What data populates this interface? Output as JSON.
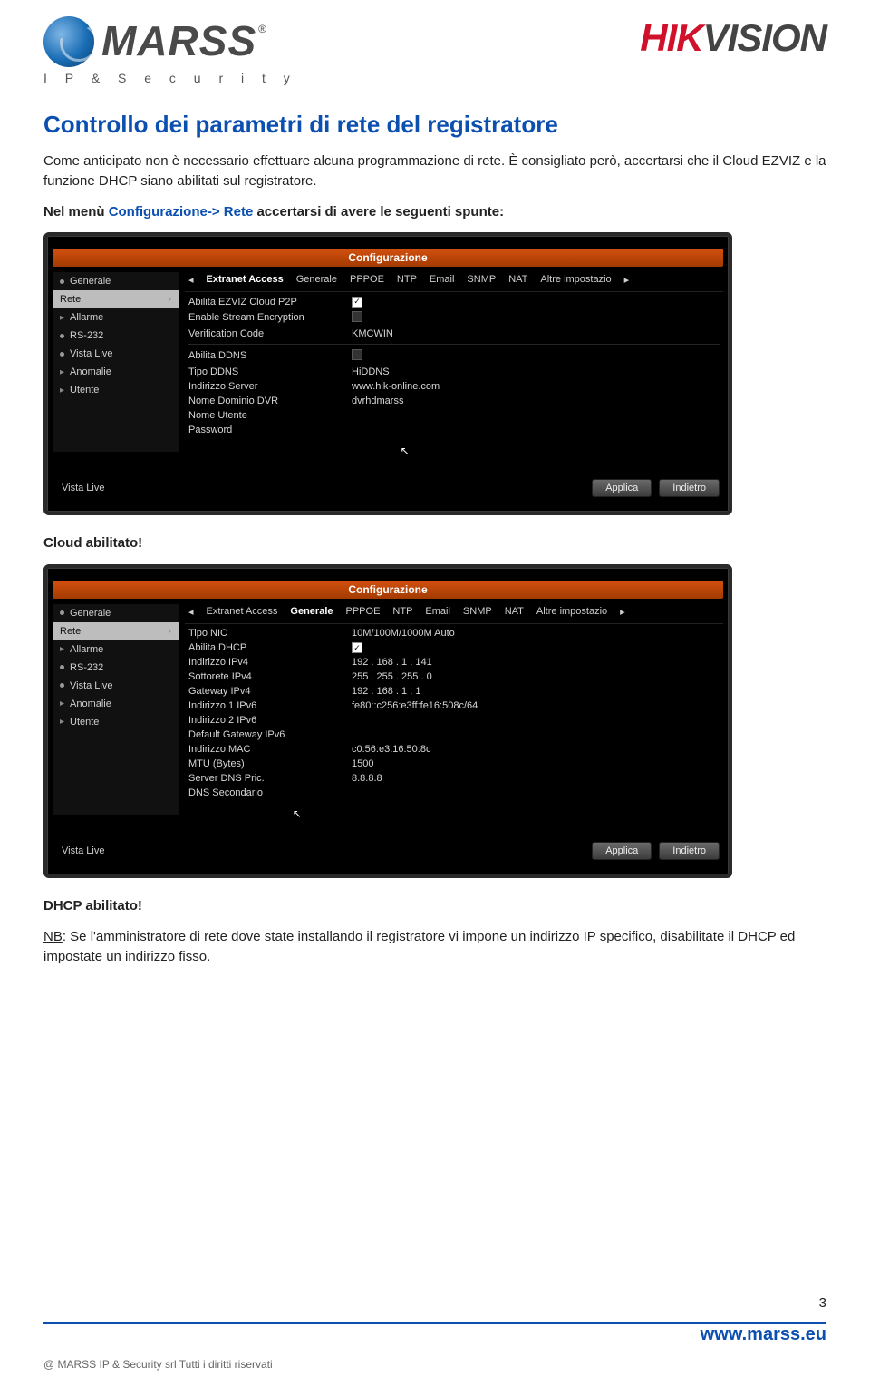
{
  "brand_left": {
    "name": "MARSS",
    "tagline": "I P  &  S e c u r i t y",
    "registered": "®"
  },
  "brand_right": {
    "hik": "HIK",
    "vision": "VISION"
  },
  "title": "Controllo dei parametri di rete del registratore",
  "p1": "Come anticipato non è necessario effettuare alcuna programmazione di rete. È consigliato però, accertarsi che il Cloud EZVIZ e la funzione DHCP siano abilitati sul registratore.",
  "p2a": "Nel menù ",
  "p2b": "Configurazione-> Rete",
  "p2c": " accertarsi di avere le seguenti spunte:",
  "cloud_caption": "Cloud abilitato!",
  "dhcp_caption": "DHCP abilitato!",
  "note_label": "NB",
  "note_text": ": Se l'amministratore di rete dove state installando il registratore vi impone un indirizzo IP specifico, disabilitate il DHCP ed impostate un indirizzo fisso.",
  "dvr_common": {
    "title": "Configurazione",
    "side": [
      "Generale",
      "Rete",
      "Allarme",
      "RS-232",
      "Vista Live",
      "Anomalie",
      "Utente"
    ],
    "tabs": [
      "Extranet Access",
      "Generale",
      "PPPOE",
      "NTP",
      "Email",
      "SNMP",
      "NAT",
      "Altre impostazio"
    ],
    "vista_live": "Vista Live",
    "btn_apply": "Applica",
    "btn_back": "Indietro"
  },
  "dvr1": {
    "active_tab": "Extranet Access",
    "rows": [
      {
        "lbl": "Abilita EZVIZ Cloud P2P",
        "type": "check",
        "checked": true
      },
      {
        "lbl": "Enable Stream Encryption",
        "type": "check",
        "checked": false
      },
      {
        "lbl": "Verification Code",
        "val": "KMCWIN"
      },
      {
        "divider": true
      },
      {
        "lbl": "Abilita DDNS",
        "type": "check",
        "checked": false
      },
      {
        "lbl": "Tipo DDNS",
        "val": "HiDDNS"
      },
      {
        "lbl": "Indirizzo Server",
        "val": "www.hik-online.com"
      },
      {
        "lbl": "Nome Dominio DVR",
        "val": "dvrhdmarss"
      },
      {
        "lbl": "Nome Utente",
        "val": ""
      },
      {
        "lbl": "Password",
        "val": ""
      }
    ]
  },
  "dvr2": {
    "active_tab": "Generale",
    "rows": [
      {
        "lbl": "Tipo NIC",
        "val": "10M/100M/1000M Auto"
      },
      {
        "lbl": "Abilita DHCP",
        "type": "check",
        "checked": true
      },
      {
        "lbl": "Indirizzo IPv4",
        "val": "192 . 168 . 1   . 141"
      },
      {
        "lbl": "Sottorete IPv4",
        "val": "255 . 255 . 255 . 0"
      },
      {
        "lbl": "Gateway IPv4",
        "val": "192 . 168 . 1   . 1"
      },
      {
        "lbl": "Indirizzo 1 IPv6",
        "val": "fe80::c256:e3ff:fe16:508c/64"
      },
      {
        "lbl": "Indirizzo 2 IPv6",
        "val": ""
      },
      {
        "lbl": "Default Gateway IPv6",
        "val": ""
      },
      {
        "lbl": "Indirizzo MAC",
        "val": "c0:56:e3:16:50:8c"
      },
      {
        "lbl": "MTU (Bytes)",
        "val": "1500"
      },
      {
        "lbl": "Server DNS Pric.",
        "val": "8.8.8.8"
      },
      {
        "lbl": "DNS Secondario",
        "val": ""
      }
    ]
  },
  "page_number": "3",
  "site": "www.marss.eu",
  "copyright": "@ MARSS IP & Security srl Tutti i diritti riservati"
}
